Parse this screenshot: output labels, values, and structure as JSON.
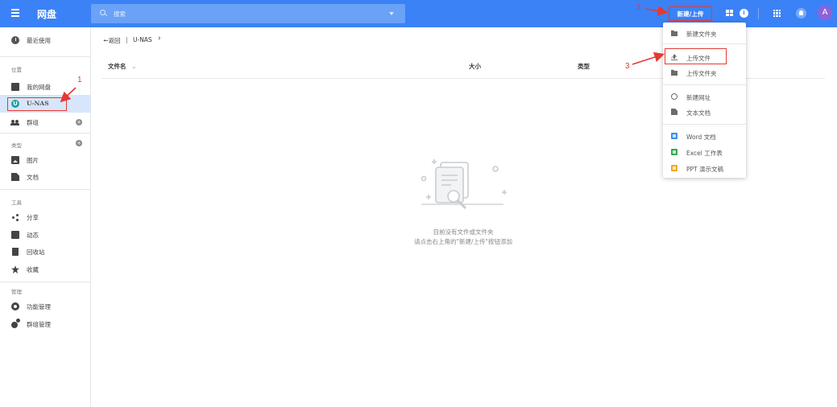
{
  "header": {
    "brand": "网盘",
    "search_placeholder": "搜索",
    "new_upload_label": "新建/上传",
    "info_icon": "i",
    "avatar_letter": "A"
  },
  "sidebar": {
    "recent": "最近使用",
    "section_location": "位置",
    "my_drive": "我的网盘",
    "unas_badge": "U",
    "unas": "U-NAS",
    "groups": "群组",
    "section_type": "类型",
    "images": "图片",
    "docs": "文档",
    "section_tools": "工具",
    "share": "分享",
    "activity": "动态",
    "recycle": "回收站",
    "favorites": "收藏",
    "section_manage": "管理",
    "feature_manage": "功能管理",
    "group_manage": "群组管理"
  },
  "main": {
    "back": "返回",
    "separator": "|",
    "current_folder": "U-NAS",
    "crumb_arrow": "›",
    "col_name": "文件名",
    "col_sort": "⌄",
    "col_size": "大小",
    "col_type": "类型",
    "empty_line1": "目前没有文件或文件夹",
    "empty_line2": "请点击右上角的\"新建/上传\"按钮添加"
  },
  "menu": {
    "new_folder": "新建文件夹",
    "upload_file": "上传文件",
    "upload_folder": "上传文件夹",
    "new_url": "新建网址",
    "text_doc": "文本文档",
    "word_doc": "Word 文档",
    "excel_doc": "Excel 工作表",
    "ppt_doc": "PPT 演示文稿"
  },
  "annotations": {
    "step1": "1",
    "step2": "2",
    "step3": "3"
  },
  "colors": {
    "topbar": "#3b82f6",
    "annotation": "#e53935",
    "active_bg": "#d7e6fb",
    "avatar": "#8e63d9"
  }
}
